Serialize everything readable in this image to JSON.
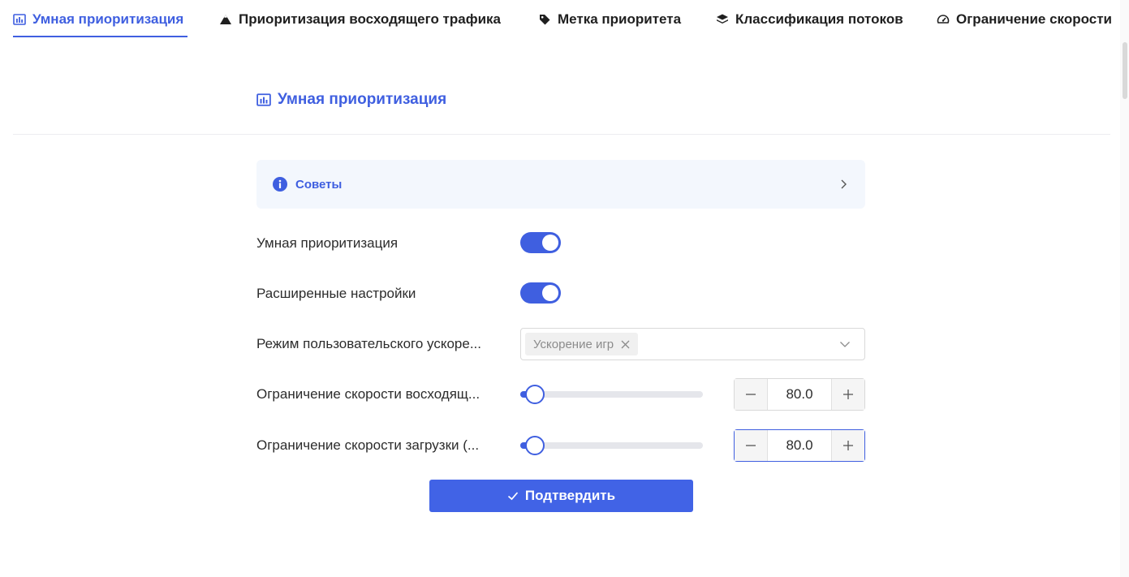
{
  "tabs": [
    {
      "label": "Умная приоритизация",
      "icon": "bar-chart-icon",
      "active": true
    },
    {
      "label": "Приоритизация восходящего трафика",
      "icon": "mountain-icon",
      "active": false
    },
    {
      "label": "Метка приоритета",
      "icon": "tag-icon",
      "active": false
    },
    {
      "label": "Классификация потоков",
      "icon": "layers-icon",
      "active": false
    },
    {
      "label": "Ограничение скорости",
      "icon": "speedometer-icon",
      "active": false
    }
  ],
  "section": {
    "title": "Умная приоритизация",
    "icon": "bar-chart-icon"
  },
  "tips": {
    "label": "Советы",
    "icon": "info-icon",
    "expand_icon": "chevron-right-icon"
  },
  "form": {
    "smart_priority": {
      "label": "Умная приоритизация",
      "enabled": true
    },
    "advanced_settings": {
      "label": "Расширенные настройки",
      "enabled": true
    },
    "acceleration_mode": {
      "label": "Режим пользовательского ускоре...",
      "selected": [
        "Ускорение игр"
      ]
    },
    "upload_limit": {
      "label": "Ограничение скорости восходящ...",
      "value": "80.0"
    },
    "download_limit": {
      "label": "Ограничение скорости загрузки (...",
      "value": "80.0"
    }
  },
  "confirm_button": {
    "label": "Подтвердить"
  },
  "colors": {
    "accent": "#3f5fe0",
    "tips_bg": "#f3f7fd"
  }
}
